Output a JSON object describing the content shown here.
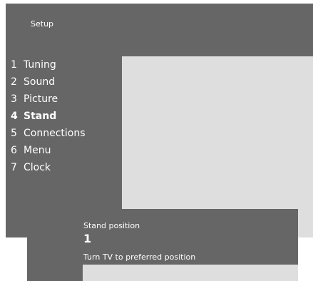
{
  "screen": {
    "title": "Setup"
  },
  "menu": {
    "items": [
      {
        "number": "1",
        "label": "Tuning",
        "active": false
      },
      {
        "number": "2",
        "label": "Sound",
        "active": false
      },
      {
        "number": "3",
        "label": "Picture",
        "active": false
      },
      {
        "number": "4",
        "label": "Stand",
        "active": true
      },
      {
        "number": "5",
        "label": "Connections",
        "active": false
      },
      {
        "number": "6",
        "label": "Menu",
        "active": false
      },
      {
        "number": "7",
        "label": "Clock",
        "active": false
      }
    ]
  },
  "dialog": {
    "heading": "Stand position",
    "value": "1",
    "instruction": "Turn TV to preferred position"
  },
  "colors": {
    "menu_background": "#666666",
    "panel_background": "#dedede",
    "text": "#ffffff"
  }
}
